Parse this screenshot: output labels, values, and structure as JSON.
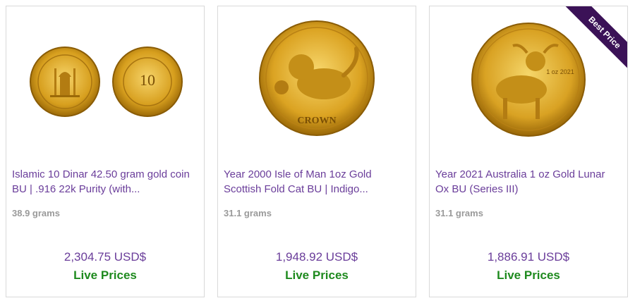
{
  "products": [
    {
      "title": "Islamic 10 Dinar 42.50 gram gold coin BU | .916 22k Purity (with...",
      "weight": "38.9 grams",
      "price": "2,304.75 USD$",
      "live_label": "Live Prices",
      "coin_text": "10"
    },
    {
      "title": "Year 2000 Isle of Man 1oz Gold Scottish Fold Cat BU | Indigo...",
      "weight": "31.1 grams",
      "price": "1,948.92 USD$",
      "live_label": "Live Prices",
      "coin_text": "CROWN"
    },
    {
      "title": "Year 2021 Australia 1 oz Gold Lunar Ox BU (Series III)",
      "weight": "31.1 grams",
      "price": "1,886.91 USD$",
      "live_label": "Live Prices",
      "badge": "Best Price",
      "coin_text": "1 oz 2021"
    }
  ],
  "colors": {
    "title": "#6a3d9a",
    "price": "#6a3d9a",
    "live": "#1e8a1e",
    "weight": "#9a9a9a",
    "ribbon": "#3b1257",
    "gold": "#d8a525"
  }
}
